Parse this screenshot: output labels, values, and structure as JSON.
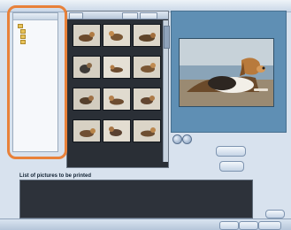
{
  "print_list": {
    "label": "List of pictures to be printed"
  },
  "colors": {
    "highlight": "#e8813a",
    "preview_background": "#5f8fb4",
    "thumbnail_background": "#2a2f36"
  },
  "icons": [
    "folder-icon",
    "rotate-left-icon",
    "rotate-right-icon",
    "scrollbar-knob"
  ]
}
